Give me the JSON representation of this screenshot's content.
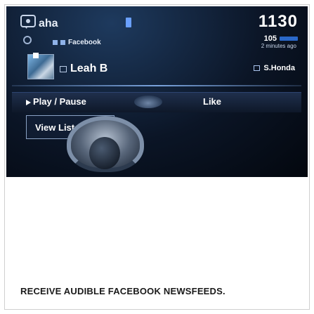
{
  "header": {
    "app_name": "aha",
    "clock": "1130",
    "like_count": "105",
    "time_ago": "2 minutes ago",
    "sender": "S.Honda"
  },
  "post": {
    "source": "Facebook",
    "name": "Leah B"
  },
  "controls": {
    "play_pause": "Play / Pause",
    "like": "Like",
    "view_list": "View List"
  },
  "caption": "RECEIVE AUDIBLE FACEBOOK NEWSFEEDS.",
  "colors": {
    "accent": "#2a68c9",
    "screen_bg": "#0b1526"
  }
}
